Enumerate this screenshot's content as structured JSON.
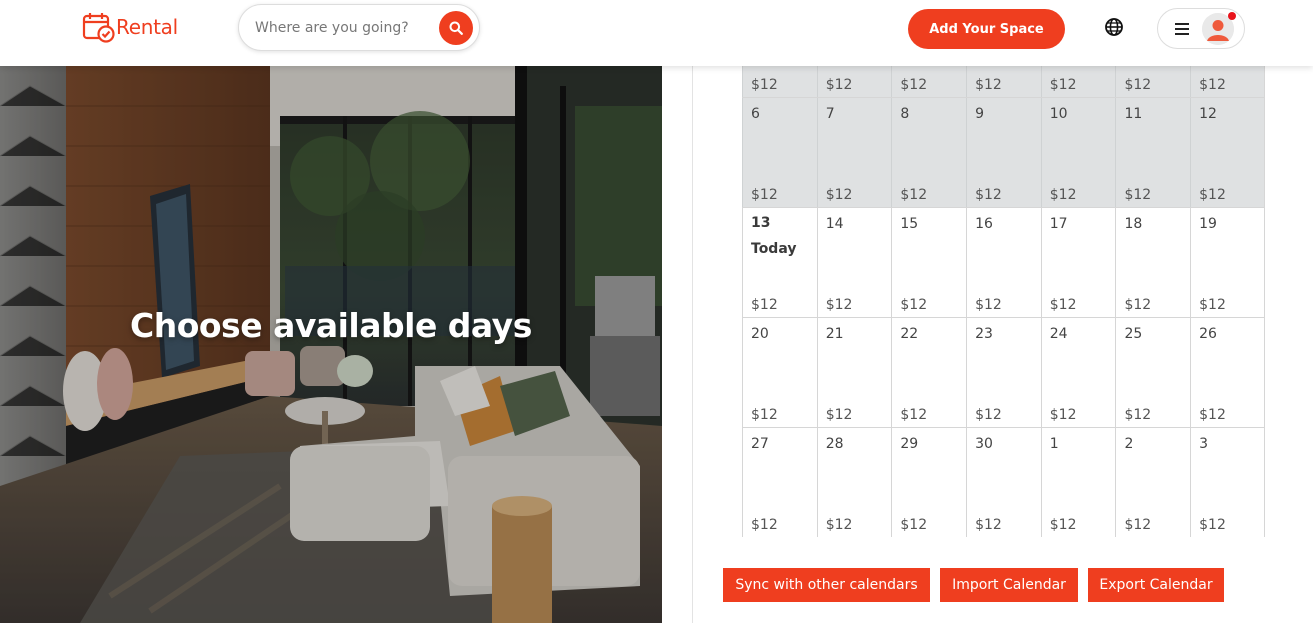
{
  "brand": {
    "name": "Rental",
    "accent_color": "#ef3e1f"
  },
  "header": {
    "search_placeholder": "Where are you going?",
    "add_space_label": "Add Your Space"
  },
  "hero": {
    "title": "Choose available days"
  },
  "calendar": {
    "partial_top_row": [
      "$12",
      "$12",
      "$12",
      "$12",
      "$12",
      "$12",
      "$12"
    ],
    "weeks": [
      {
        "state": "past",
        "days": [
          {
            "day": "6",
            "price": "$12"
          },
          {
            "day": "7",
            "price": "$12"
          },
          {
            "day": "8",
            "price": "$12"
          },
          {
            "day": "9",
            "price": "$12"
          },
          {
            "day": "10",
            "price": "$12"
          },
          {
            "day": "11",
            "price": "$12"
          },
          {
            "day": "12",
            "price": "$12"
          }
        ]
      },
      {
        "state": "current",
        "days": [
          {
            "day": "13",
            "label": "Today",
            "price": "$12"
          },
          {
            "day": "14",
            "price": "$12"
          },
          {
            "day": "15",
            "price": "$12"
          },
          {
            "day": "16",
            "price": "$12"
          },
          {
            "day": "17",
            "price": "$12"
          },
          {
            "day": "18",
            "price": "$12"
          },
          {
            "day": "19",
            "price": "$12"
          }
        ]
      },
      {
        "state": "future",
        "days": [
          {
            "day": "20",
            "price": "$12"
          },
          {
            "day": "21",
            "price": "$12"
          },
          {
            "day": "22",
            "price": "$12"
          },
          {
            "day": "23",
            "price": "$12"
          },
          {
            "day": "24",
            "price": "$12"
          },
          {
            "day": "25",
            "price": "$12"
          },
          {
            "day": "26",
            "price": "$12"
          }
        ]
      },
      {
        "state": "future",
        "days": [
          {
            "day": "27",
            "price": "$12"
          },
          {
            "day": "28",
            "price": "$12"
          },
          {
            "day": "29",
            "price": "$12"
          },
          {
            "day": "30",
            "price": "$12"
          },
          {
            "day": "1",
            "price": "$12"
          },
          {
            "day": "2",
            "price": "$12"
          },
          {
            "day": "3",
            "price": "$12"
          }
        ]
      }
    ]
  },
  "actions": {
    "sync_label": "Sync with other calendars",
    "import_label": "Import Calendar",
    "export_label": "Export Calendar"
  },
  "icons": {
    "logo": "calendar-check-icon",
    "search": "search-icon",
    "language": "globe-icon",
    "menu": "hamburger-menu-icon",
    "profile": "user-avatar-icon"
  }
}
